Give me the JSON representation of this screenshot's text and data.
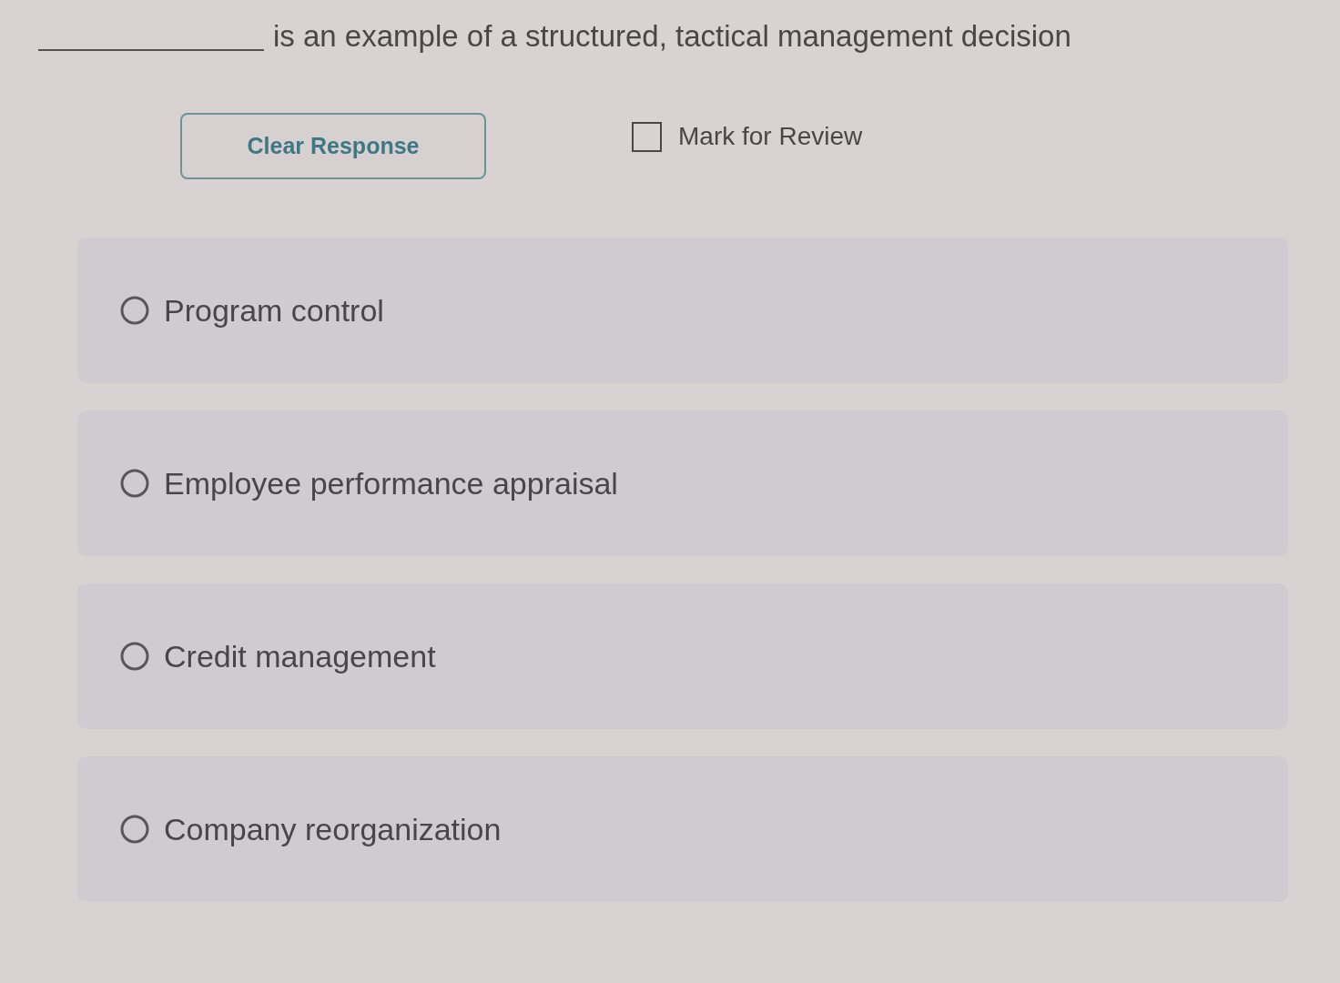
{
  "question": {
    "text": "is an example of a structured, tactical management decision"
  },
  "clear_button": {
    "label": "Clear Response"
  },
  "mark_for_review": {
    "label": "Mark for Review",
    "checked": false
  },
  "options": [
    {
      "label": "Program control",
      "selected": false
    },
    {
      "label": "Employee performance appraisal",
      "selected": false
    },
    {
      "label": "Credit management",
      "selected": false
    },
    {
      "label": "Company reorganization",
      "selected": false
    }
  ]
}
